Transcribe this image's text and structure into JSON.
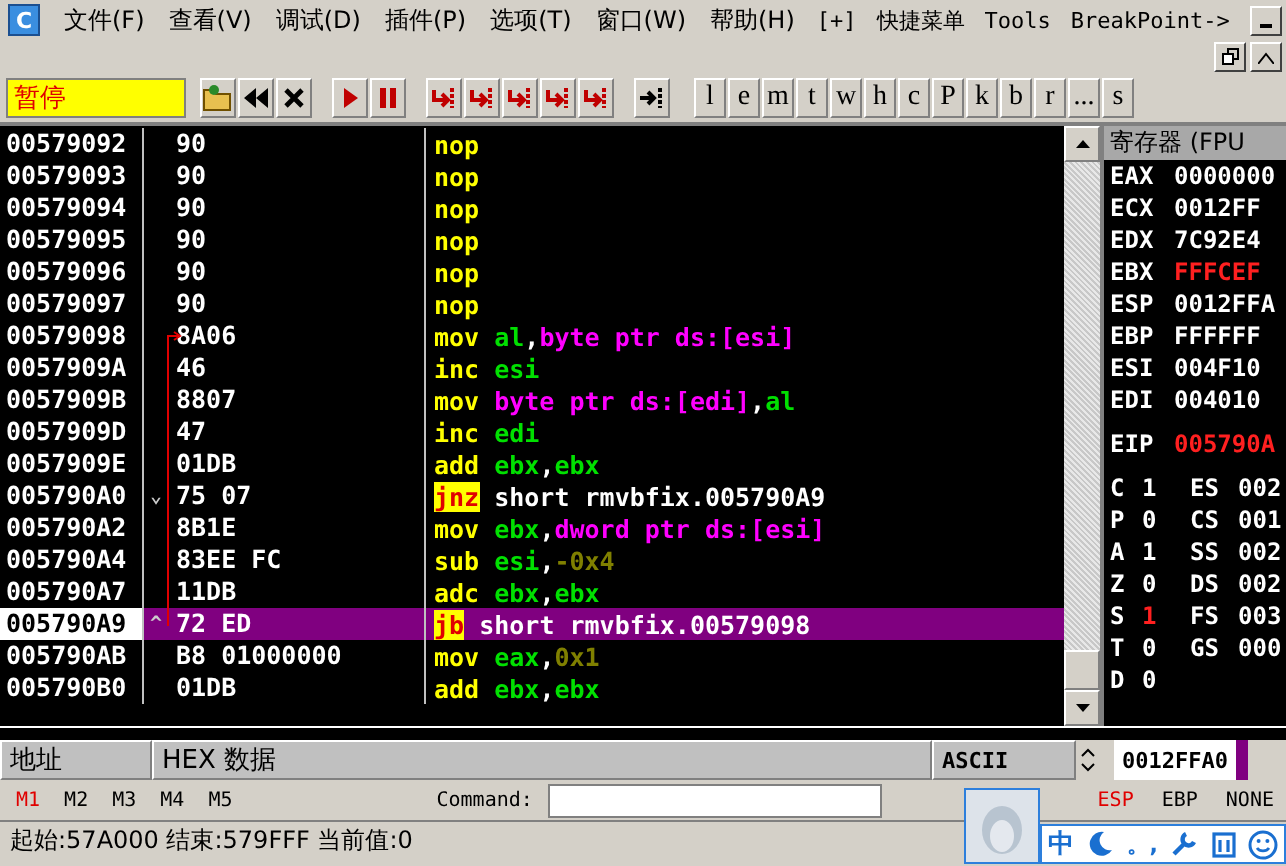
{
  "menu": {
    "logo": "C",
    "items": [
      "文件(F)",
      "查看(V)",
      "调试(D)",
      "插件(P)",
      "选项(T)",
      "窗口(W)",
      "帮助(H)",
      "[+]",
      "快捷菜单",
      "Tools",
      "BreakPoint->"
    ]
  },
  "toolbar": {
    "status": "暂停",
    "buttons": [
      {
        "kind": "open"
      },
      {
        "kind": "rewind"
      },
      {
        "kind": "close"
      },
      {
        "kind": "run"
      },
      {
        "kind": "pause"
      },
      {
        "kind": "step"
      },
      {
        "kind": "step"
      },
      {
        "kind": "step"
      },
      {
        "kind": "step"
      },
      {
        "kind": "step"
      },
      {
        "kind": "goto"
      }
    ],
    "letters": [
      "l",
      "e",
      "m",
      "t",
      "w",
      "h",
      "c",
      "P",
      "k",
      "b",
      "r",
      "...",
      "s"
    ]
  },
  "disasm": {
    "rows": [
      {
        "address": "00579092",
        "hex": "90",
        "marker": "",
        "selected": false,
        "ops": [
          {
            "kind": "mnem",
            "text": "nop"
          }
        ]
      },
      {
        "address": "00579093",
        "hex": "90",
        "marker": "",
        "selected": false,
        "ops": [
          {
            "kind": "mnem",
            "text": "nop"
          }
        ]
      },
      {
        "address": "00579094",
        "hex": "90",
        "marker": "",
        "selected": false,
        "ops": [
          {
            "kind": "mnem",
            "text": "nop"
          }
        ]
      },
      {
        "address": "00579095",
        "hex": "90",
        "marker": "",
        "selected": false,
        "ops": [
          {
            "kind": "mnem",
            "text": "nop"
          }
        ]
      },
      {
        "address": "00579096",
        "hex": "90",
        "marker": "",
        "selected": false,
        "ops": [
          {
            "kind": "mnem",
            "text": "nop"
          }
        ]
      },
      {
        "address": "00579097",
        "hex": "90",
        "marker": "",
        "selected": false,
        "ops": [
          {
            "kind": "mnem",
            "text": "nop"
          }
        ]
      },
      {
        "address": "00579098",
        "hex": "8A06",
        "marker": "",
        "selected": false,
        "ops": [
          {
            "kind": "mnem",
            "text": "mov"
          },
          {
            "kind": "reg",
            "text": "al"
          },
          {
            "kind": "plain",
            "text": ","
          },
          {
            "kind": "mem",
            "text": "byte ptr ds:[esi]"
          }
        ]
      },
      {
        "address": "0057909A",
        "hex": "46",
        "marker": "",
        "selected": false,
        "ops": [
          {
            "kind": "mnem",
            "text": "inc"
          },
          {
            "kind": "reg",
            "text": "esi"
          }
        ]
      },
      {
        "address": "0057909B",
        "hex": "8807",
        "marker": "",
        "selected": false,
        "ops": [
          {
            "kind": "mnem",
            "text": "mov"
          },
          {
            "kind": "mem",
            "text": "byte ptr ds:[edi]"
          },
          {
            "kind": "plain",
            "text": ","
          },
          {
            "kind": "reg",
            "text": "al"
          }
        ]
      },
      {
        "address": "0057909D",
        "hex": "47",
        "marker": "",
        "selected": false,
        "ops": [
          {
            "kind": "mnem",
            "text": "inc"
          },
          {
            "kind": "reg",
            "text": "edi"
          }
        ]
      },
      {
        "address": "0057909E",
        "hex": "01DB",
        "marker": "",
        "selected": false,
        "ops": [
          {
            "kind": "mnem",
            "text": "add"
          },
          {
            "kind": "reg",
            "text": "ebx"
          },
          {
            "kind": "plain",
            "text": ","
          },
          {
            "kind": "reg",
            "text": "ebx"
          }
        ]
      },
      {
        "address": "005790A0",
        "hex": "75 07",
        "marker": "⌄",
        "selected": false,
        "ops": [
          {
            "kind": "jump",
            "text": "jnz"
          },
          {
            "kind": "plain",
            "text": "short rmvbfix.005790A9"
          }
        ]
      },
      {
        "address": "005790A2",
        "hex": "8B1E",
        "marker": "",
        "selected": false,
        "ops": [
          {
            "kind": "mnem",
            "text": "mov"
          },
          {
            "kind": "reg",
            "text": "ebx"
          },
          {
            "kind": "plain",
            "text": ","
          },
          {
            "kind": "mem",
            "text": "dword ptr ds:[esi]"
          }
        ]
      },
      {
        "address": "005790A4",
        "hex": "83EE FC",
        "marker": "",
        "selected": false,
        "ops": [
          {
            "kind": "mnem",
            "text": "sub"
          },
          {
            "kind": "reg",
            "text": "esi"
          },
          {
            "kind": "plain",
            "text": ","
          },
          {
            "kind": "num",
            "text": "-0x4"
          }
        ]
      },
      {
        "address": "005790A7",
        "hex": "11DB",
        "marker": "",
        "selected": false,
        "ops": [
          {
            "kind": "mnem",
            "text": "adc"
          },
          {
            "kind": "reg",
            "text": "ebx"
          },
          {
            "kind": "plain",
            "text": ","
          },
          {
            "kind": "reg",
            "text": "ebx"
          }
        ]
      },
      {
        "address": "005790A9",
        "hex": "72 ED",
        "marker": "^",
        "selected": true,
        "ops": [
          {
            "kind": "jump",
            "text": "jb"
          },
          {
            "kind": "plain",
            "text": "short rmvbfix.00579098"
          }
        ]
      },
      {
        "address": "005790AB",
        "hex": "B8 01000000",
        "marker": "",
        "selected": false,
        "ops": [
          {
            "kind": "mnem",
            "text": "mov"
          },
          {
            "kind": "reg",
            "text": "eax"
          },
          {
            "kind": "plain",
            "text": ","
          },
          {
            "kind": "num",
            "text": "0x1"
          }
        ]
      },
      {
        "address": "005790B0",
        "hex": "01DB",
        "marker": "",
        "selected": false,
        "ops": [
          {
            "kind": "mnem",
            "text": "add"
          },
          {
            "kind": "reg",
            "text": "ebx"
          },
          {
            "kind": "plain",
            "text": ","
          },
          {
            "kind": "reg",
            "text": "ebx"
          }
        ]
      }
    ]
  },
  "registers": {
    "title": "寄存器 (FPU",
    "general": [
      {
        "name": "EAX",
        "value": "0000000",
        "changed": false
      },
      {
        "name": "ECX",
        "value": "0012FF",
        "changed": false
      },
      {
        "name": "EDX",
        "value": "7C92E4",
        "changed": false
      },
      {
        "name": "EBX",
        "value": "FFFCEF",
        "changed": true
      },
      {
        "name": "ESP",
        "value": "0012FFA",
        "changed": false
      },
      {
        "name": "EBP",
        "value": "FFFFFF",
        "changed": false
      },
      {
        "name": "ESI",
        "value": "004F10",
        "changed": false
      },
      {
        "name": "EDI",
        "value": "004010",
        "changed": false
      }
    ],
    "eip": {
      "name": "EIP",
      "value": "005790A",
      "changed": true
    },
    "flags": [
      {
        "flag": "C",
        "value": "1",
        "changed": false,
        "seg": "ES",
        "segval": "002"
      },
      {
        "flag": "P",
        "value": "0",
        "changed": false,
        "seg": "CS",
        "segval": "001"
      },
      {
        "flag": "A",
        "value": "1",
        "changed": false,
        "seg": "SS",
        "segval": "002"
      },
      {
        "flag": "Z",
        "value": "0",
        "changed": false,
        "seg": "DS",
        "segval": "002"
      },
      {
        "flag": "S",
        "value": "1",
        "changed": true,
        "seg": "FS",
        "segval": "003"
      },
      {
        "flag": "T",
        "value": "0",
        "changed": false,
        "seg": "GS",
        "segval": "000"
      },
      {
        "flag": "D",
        "value": "0",
        "changed": false
      }
    ]
  },
  "dump": {
    "columns": [
      "地址",
      "HEX 数据",
      "ASCII"
    ],
    "stack_address": "0012FFA0"
  },
  "command_bar": {
    "tabs": [
      {
        "label": "M1",
        "selected": true
      },
      {
        "label": "M2",
        "selected": false
      },
      {
        "label": "M3",
        "selected": false
      },
      {
        "label": "M4",
        "selected": false
      },
      {
        "label": "M5",
        "selected": false
      }
    ],
    "label": "Command:",
    "modes": [
      {
        "label": "ESP",
        "selected": true
      },
      {
        "label": "EBP",
        "selected": false
      },
      {
        "label": "NONE",
        "selected": false
      }
    ]
  },
  "status_bar": "起始:57A000 结束:579FFF 当前值:0",
  "ime": {
    "mode": "中",
    "punct": "。,"
  }
}
